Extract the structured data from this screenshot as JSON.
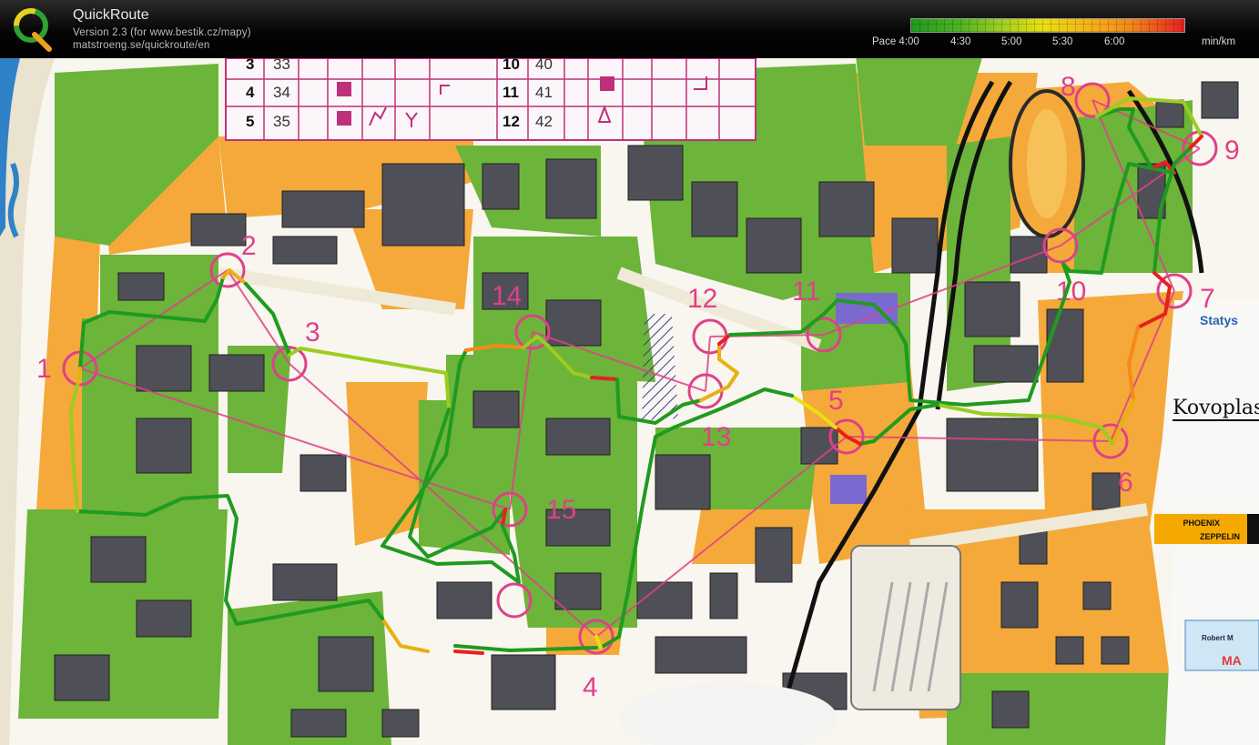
{
  "app": {
    "title": "QuickRoute",
    "version": "Version 2.3  (for www.bestik.cz/mapy)",
    "url": "matstroeng.se/quickroute/en"
  },
  "pace_scale": {
    "labels": [
      "Pace 4:00",
      "4:30",
      "5:00",
      "5:30",
      "6:00"
    ],
    "unit": "min/km",
    "colors": [
      "#1f9b1f",
      "#9acd20",
      "#e8e010",
      "#f7b417",
      "#e62020"
    ]
  },
  "map": {
    "controls": [
      "1",
      "2",
      "3",
      "4",
      "5",
      "6",
      "7",
      "8",
      "9",
      "10",
      "11",
      "12",
      "13",
      "14",
      "15"
    ],
    "description_sheet": {
      "rows_left": [
        [
          "3",
          "33"
        ],
        [
          "4",
          "34"
        ],
        [
          "5",
          "35"
        ]
      ],
      "rows_right": [
        [
          "10",
          "40"
        ],
        [
          "11",
          "41"
        ],
        [
          "12",
          "42"
        ]
      ]
    },
    "text_labels": {
      "kovoplast": "Kovoplas",
      "statys": "Statys",
      "phoenix": "PHOENIX",
      "zeppelin": "ZEPPELIN",
      "sign_m": "MA",
      "sign_robert": "Robert M"
    }
  }
}
